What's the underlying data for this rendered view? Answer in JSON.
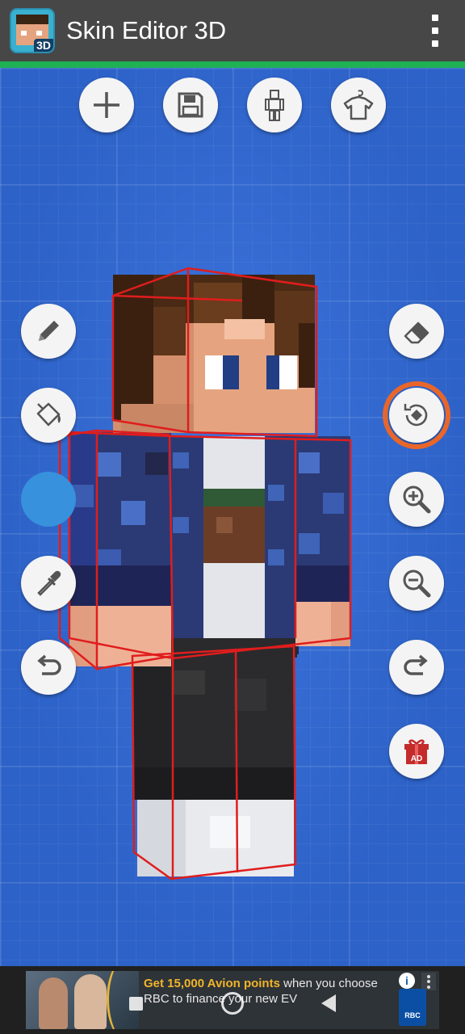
{
  "appbar": {
    "title": "Skin Editor 3D",
    "app_icon_badge": "3D"
  },
  "colors": {
    "appbar_bg": "#474747",
    "accent": "#1fb154",
    "canvas_bg": "#2d62c8",
    "current_paint_color": "#3791dc",
    "active_ring": "#e8662a"
  },
  "toolbar": [
    {
      "name": "new-skin-button",
      "icon": "plus-icon"
    },
    {
      "name": "save-button",
      "icon": "floppy-disk-icon"
    },
    {
      "name": "body-part-selector-button",
      "icon": "player-model-icon"
    },
    {
      "name": "wardrobe-button",
      "icon": "shirt-on-hanger-icon"
    }
  ],
  "left_tools": [
    {
      "name": "pencil-tool-button",
      "icon": "pencil-icon"
    },
    {
      "name": "fill-bucket-tool-button",
      "icon": "paint-bucket-icon"
    },
    {
      "name": "color-swatch-button",
      "icon": "color-circle"
    },
    {
      "name": "eyedropper-tool-button",
      "icon": "eyedropper-icon"
    },
    {
      "name": "undo-button",
      "icon": "undo-arrow-icon"
    }
  ],
  "right_tools": [
    {
      "name": "eraser-tool-button",
      "icon": "eraser-icon"
    },
    {
      "name": "rotate-mode-button",
      "icon": "rotate-view-icon",
      "active": true
    },
    {
      "name": "zoom-in-button",
      "icon": "zoom-in-icon"
    },
    {
      "name": "zoom-out-button",
      "icon": "zoom-out-icon"
    },
    {
      "name": "redo-button",
      "icon": "redo-arrow-icon"
    },
    {
      "name": "ad-gift-button",
      "icon": "gift-icon",
      "label": "AD"
    }
  ],
  "ad": {
    "highlight": "Get 15,000 Avion points",
    "text_rest": " when you choose RBC to finance your new EV",
    "brand": "RBC",
    "info_icon": "i"
  }
}
